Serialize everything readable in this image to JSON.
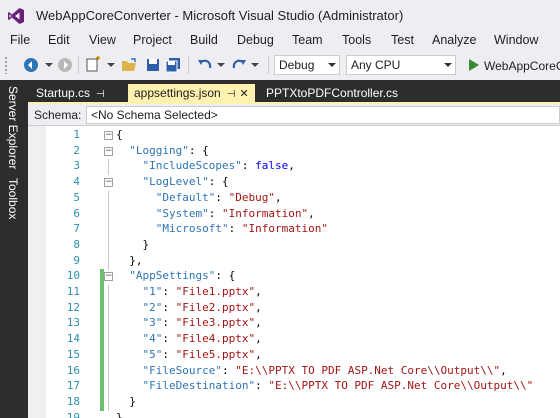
{
  "window": {
    "title": "WebAppCoreConverter - Microsoft Visual Studio (Administrator)"
  },
  "menu": [
    "File",
    "Edit",
    "View",
    "Project",
    "Build",
    "Debug",
    "Team",
    "Tools",
    "Test",
    "Analyze",
    "Window"
  ],
  "toolbar": {
    "config": "Debug",
    "platform": "Any CPU",
    "run_label": "WebAppCoreC"
  },
  "side_tabs": [
    "Server Explorer",
    "Toolbox"
  ],
  "tabs": [
    {
      "label": "Startup.cs",
      "active": false
    },
    {
      "label": "appsettings.json",
      "active": true
    },
    {
      "label": "PPTXtoPDFController.cs",
      "active": false
    }
  ],
  "schema": {
    "label": "Schema:",
    "value": "<No Schema Selected>"
  },
  "colors": {
    "accent": "#fff2b0",
    "dark": "#2d2d30",
    "key": "#2e75b6",
    "string": "#a31515",
    "keyword": "#0000ff",
    "changed": "#6cc06c"
  },
  "code_lines": [
    "{",
    "  \"Logging\": {",
    "    \"IncludeScopes\": false,",
    "    \"LogLevel\": {",
    "      \"Default\": \"Debug\",",
    "      \"System\": \"Information\",",
    "      \"Microsoft\": \"Information\"",
    "    }",
    "  },",
    "  \"AppSettings\": {",
    "    \"1\": \"File1.pptx\",",
    "    \"2\": \"File2.pptx\",",
    "    \"3\": \"File3.pptx\",",
    "    \"4\": \"File4.pptx\",",
    "    \"5\": \"File5.pptx\",",
    "    \"FileSource\": \"E:\\\\PPTX TO PDF ASP.Net Core\\\\Output\\\\\",",
    "    \"FileDestination\": \"E:\\\\PPTX TO PDF ASP.Net Core\\\\Output\\\\\"",
    "  }",
    "}"
  ],
  "line_numbers": [
    "1",
    "2",
    "3",
    "4",
    "5",
    "6",
    "7",
    "8",
    "9",
    "10",
    "11",
    "12",
    "13",
    "14",
    "15",
    "16",
    "17",
    "18",
    "19"
  ]
}
